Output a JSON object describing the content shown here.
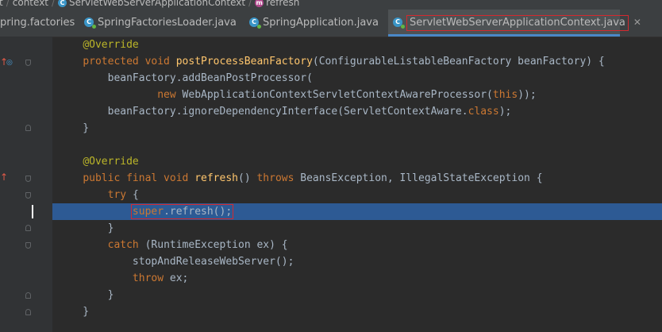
{
  "breadcrumb": {
    "items": [
      {
        "label": "t",
        "icon": "folder"
      },
      {
        "label": "context",
        "icon": "folder"
      },
      {
        "label": "ServletWebServerApplicationContext",
        "icon": "class-icon"
      },
      {
        "label": "refresh",
        "icon": "method-icon"
      }
    ]
  },
  "tabs": [
    {
      "label": "pring.factories",
      "icon": "file-icon",
      "active": false
    },
    {
      "label": "SpringFactoriesLoader.java",
      "icon": "class-icon",
      "active": false
    },
    {
      "label": "SpringApplication.java",
      "icon": "class-icon",
      "active": false
    },
    {
      "label": "ServletWebServerApplicationContext.java",
      "icon": "class-icon",
      "active": true,
      "close": "✕"
    }
  ],
  "code": {
    "current_line_index": 10,
    "lines": [
      [
        {
          "t": "    "
        },
        {
          "t": "@Override",
          "c": "ann"
        }
      ],
      [
        {
          "t": "    "
        },
        {
          "t": "protected void ",
          "c": "kw"
        },
        {
          "t": "postProcessBeanFactory",
          "c": "fn"
        },
        {
          "t": "(ConfigurableListableBeanFactory beanFactory) {"
        }
      ],
      [
        {
          "t": "        beanFactory.addBeanPostProcessor("
        }
      ],
      [
        {
          "t": "                "
        },
        {
          "t": "new ",
          "c": "kw"
        },
        {
          "t": "WebApplicationContextServletContextAwareProcessor("
        },
        {
          "t": "this",
          "c": "kw"
        },
        {
          "t": "));"
        }
      ],
      [
        {
          "t": "        beanFactory.ignoreDependencyInterface(ServletContextAware."
        },
        {
          "t": "class",
          "c": "kw"
        },
        {
          "t": ");"
        }
      ],
      [
        {
          "t": "    }"
        }
      ],
      [
        {
          "t": ""
        }
      ],
      [
        {
          "t": "    "
        },
        {
          "t": "@Override",
          "c": "ann"
        }
      ],
      [
        {
          "t": "    "
        },
        {
          "t": "public final void ",
          "c": "kw"
        },
        {
          "t": "refresh",
          "c": "fn"
        },
        {
          "t": "() "
        },
        {
          "t": "throws ",
          "c": "kw"
        },
        {
          "t": "BeansException, IllegalStateException {"
        }
      ],
      [
        {
          "t": "        "
        },
        {
          "t": "try ",
          "c": "kw"
        },
        {
          "t": "{"
        }
      ],
      [
        {
          "t": "            "
        },
        {
          "t": "super",
          "c": "kw",
          "h": "start"
        },
        {
          "t": ".refresh();",
          "h": "end"
        }
      ],
      [
        {
          "t": "        }"
        }
      ],
      [
        {
          "t": "        "
        },
        {
          "t": "catch ",
          "c": "kw"
        },
        {
          "t": "(RuntimeException ex) {"
        }
      ],
      [
        {
          "t": "            stopAndReleaseWebServer();"
        }
      ],
      [
        {
          "t": "            "
        },
        {
          "t": "throw ",
          "c": "kw"
        },
        {
          "t": "ex;"
        }
      ],
      [
        {
          "t": "        }"
        }
      ],
      [
        {
          "t": "    }"
        }
      ]
    ]
  },
  "gutter": {
    "markers": [
      {
        "line": 1,
        "icons": [
          "override-up-icon",
          "overridden-icon"
        ]
      },
      {
        "line": 8,
        "icons": [
          "override-up-icon"
        ]
      }
    ]
  },
  "colors": {
    "background": "#2b2b2b",
    "keyword": "#cc7832",
    "annotation": "#bbb529",
    "method": "#ffc66d",
    "text": "#a9b7c6",
    "current_line": "#2d5a94",
    "highlight_box": "#d4292f"
  }
}
